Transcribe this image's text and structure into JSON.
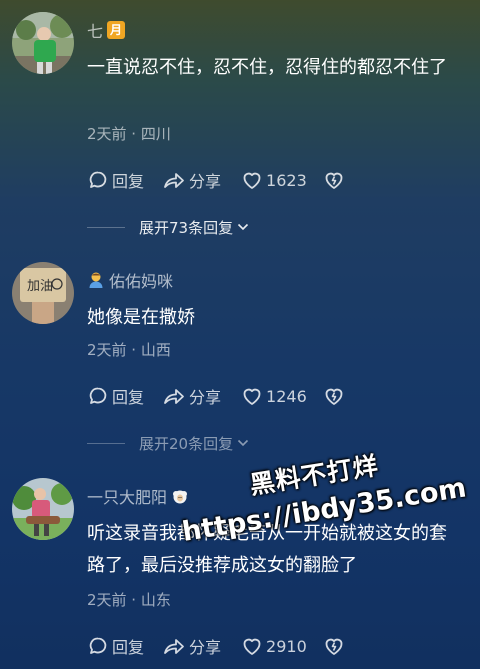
{
  "comments": [
    {
      "username": "七",
      "badge": "月",
      "text": "一直说忍不住，忍不住，忍得住的都忍不住了",
      "meta": "2天前 · 四川",
      "reply_label": "回复",
      "share_label": "分享",
      "likes": "1623",
      "expand_label": "展开73条回复"
    },
    {
      "username_prefix_icon": "person-emoji-icon",
      "username": "佑佑妈咪",
      "text": "她像是在撒娇",
      "meta": "2天前 · 山西",
      "reply_label": "回复",
      "share_label": "分享",
      "likes": "1246",
      "expand_label": "展开20条回复"
    },
    {
      "username": "一只大肥阳",
      "username_suffix_icon": "sheep-emoji-icon",
      "text": "听这录音我都怀疑毛奇从一开始就被这女的套路了，最后没推荐成这女的翻脸了",
      "meta": "2天前 · 山东",
      "reply_label": "回复",
      "share_label": "分享",
      "likes": "2910"
    }
  ],
  "avatar2_text": "加油",
  "watermark": {
    "line1": "黑料不打烊",
    "line2": "https://ibdy35.com"
  },
  "colors": {
    "badge": "#f0a623",
    "text_primary": "#ffffff",
    "text_secondary": "rgba(255,255,255,0.6)"
  }
}
